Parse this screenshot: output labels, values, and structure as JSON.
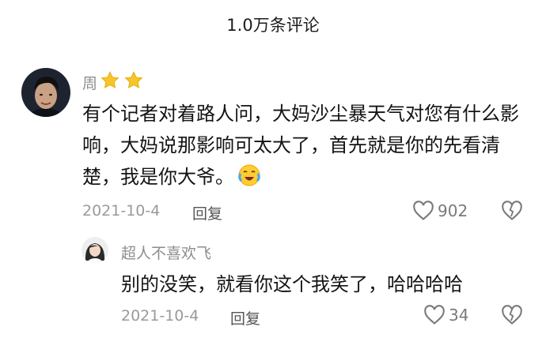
{
  "header": {
    "title": "1.0万条评论"
  },
  "comments": [
    {
      "username": "周",
      "badges": [
        "star-icon",
        "star-icon"
      ],
      "text": "有个记者对着路人问，大妈沙尘暴天气对您有什么影响，大妈说那影响可太大了，首先就是你的先看清楚，我是你大爷。",
      "emoji": "crying-laughing-emoji",
      "date": "2021-10-4",
      "reply_label": "回复",
      "likes": "902",
      "replies": [
        {
          "username": "超人不喜欢飞",
          "text": "别的没笑，就看你这个我笑了，哈哈哈哈",
          "date": "2021-10-4",
          "reply_label": "回复",
          "likes": "34"
        }
      ]
    }
  ],
  "colors": {
    "username": "#8d8d8d",
    "meta": "#9a9a9a",
    "text": "#141414",
    "star": "#f7c52b"
  }
}
